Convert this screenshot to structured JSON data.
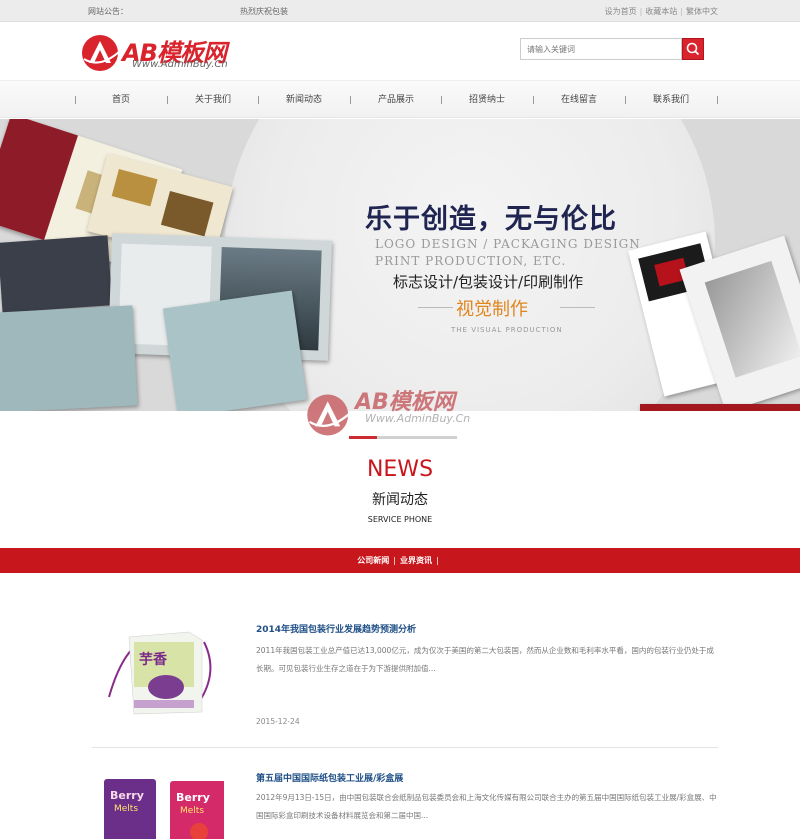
{
  "topbar": {
    "notice": "网站公告：",
    "hot": "热烈庆祝包装",
    "links": [
      "设为首页",
      "收藏本站",
      "繁体中文"
    ]
  },
  "logo": {
    "name": "AB模板网",
    "sub": "Www.AdminBuy.Cn"
  },
  "search": {
    "placeholder": "请输入关键词",
    "icon": "search-icon"
  },
  "nav": [
    "首页",
    "关于我们",
    "新闻动态",
    "产品展示",
    "招贤纳士",
    "在线留言",
    "联系我们"
  ],
  "banner": {
    "headline": "乐于创造，无与伦比",
    "line1": "LOGO DESIGN / PACKAGING DESIGN",
    "line2": "PRINT PRODUCTION, ETC.",
    "line3": "标志设计/包装设计/印刷制作",
    "line4": "视觉制作",
    "line5": "THE VISUAL PRODUCTION"
  },
  "news_section": {
    "title_en": "NEWS",
    "title_cn": "新闻动态",
    "subtitle": "SERVICE PHONE",
    "tabs": [
      "公司新闻",
      "业界资讯"
    ]
  },
  "news_items": [
    {
      "title": "2014年我国包装行业发展趋势预测分析",
      "desc": "2011年我国包装工业总产值已达13,000亿元，成为仅次于美国的第二大包装国，然而从企业数和毛利率水平看，国内的包装行业仍处于成长期。可见包装行业生存之道在于为下游提供附加值...",
      "date": "2015-12-24"
    },
    {
      "title": "第五届中国国际纸包装工业展/彩盒展",
      "desc": "2012年9月13日-15日，由中国包装联合会纸制品包装委员会和上海文化传媒有限公司联合主办的第五届中国国际纸包装工业展/彩盒展、中国国际彩盒印刷技术设备材料展览会和第二届中国...",
      "date": ""
    }
  ],
  "colors": {
    "brand_red": "#c8161d",
    "title_blue": "#1f4f86",
    "headline_navy": "#1f2550",
    "accent_orange": "#e0861e"
  }
}
